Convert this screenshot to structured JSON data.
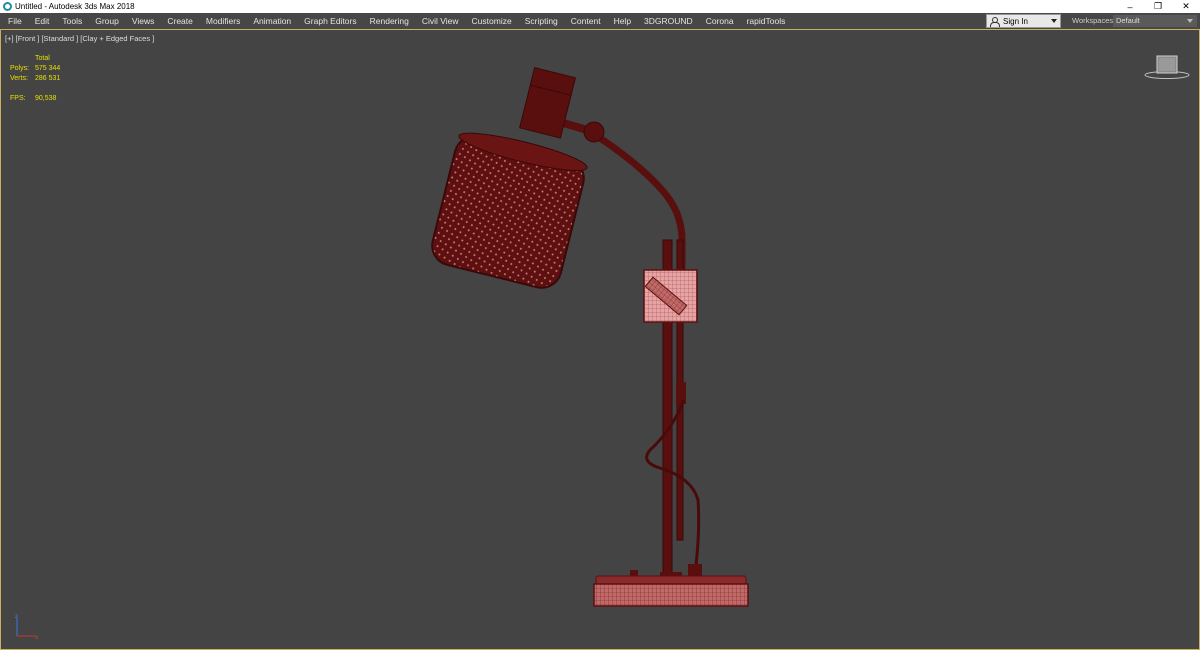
{
  "window": {
    "title": "Untitled - Autodesk 3ds Max 2018",
    "app_icon": "3ds-max-icon",
    "controls": {
      "minimize": "–",
      "restore": "❐",
      "close": "✕"
    }
  },
  "menu": {
    "items": [
      "File",
      "Edit",
      "Tools",
      "Group",
      "Views",
      "Create",
      "Modifiers",
      "Animation",
      "Graph Editors",
      "Rendering",
      "Civil View",
      "Customize",
      "Scripting",
      "Content",
      "Help",
      "3DGROUND",
      "Corona",
      "rapidTools"
    ],
    "sign_in": "Sign In",
    "workspaces_label": "Workspaces:",
    "workspaces_value": "Default"
  },
  "viewport": {
    "label": "[+] [Front ] [Standard ] [Clay + Edged Faces ]",
    "stats": {
      "header": "Total",
      "polys_label": "Polys:",
      "polys_value": "575 344",
      "verts_label": "Verts:",
      "verts_value": "286 531",
      "fps_label": "FPS:",
      "fps_value": "90,538"
    }
  },
  "colors": {
    "viewport_bg": "#444444",
    "stats_text": "#e8e000",
    "model": "#5a0f0f",
    "model_wire": "#b05a5a",
    "model_highlight": "#d48b8b"
  }
}
